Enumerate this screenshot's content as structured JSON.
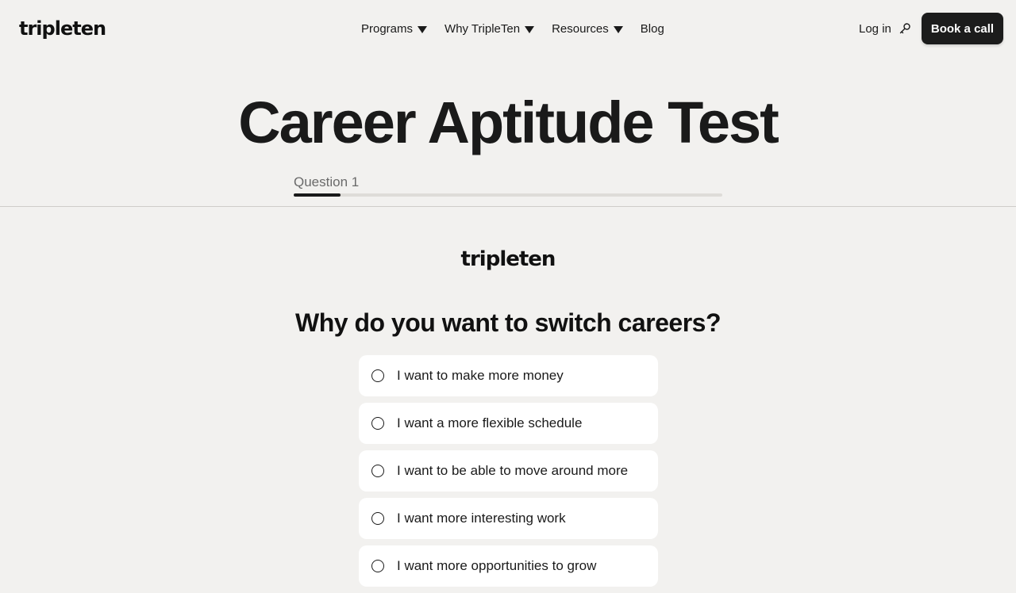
{
  "nav": {
    "logo": "tripleten",
    "menu": [
      {
        "label": "Programs",
        "icon": "caret-down-icon"
      },
      {
        "label": "Why TripleTen",
        "icon": "caret-down-icon"
      },
      {
        "label": "Resources",
        "icon": "caret-down-icon"
      },
      {
        "label": "Blog"
      }
    ],
    "login_label": "Log in",
    "login_icon": "key-icon",
    "cta_label": "Book a call"
  },
  "hero": {
    "title": "Career Aptitude Test",
    "question_label": "Question 1",
    "progress_fraction": 0.11
  },
  "quiz": {
    "logo": "tripleten",
    "question": "Why do you want to switch careers?",
    "options": [
      {
        "label": "I want to make more money"
      },
      {
        "label": "I want a more flexible schedule"
      },
      {
        "label": "I want to be able to move around more"
      },
      {
        "label": "I want more interesting work"
      },
      {
        "label": "I want more opportunities to grow"
      }
    ]
  },
  "colors": {
    "background": "#f2f1ef",
    "text": "#1a1a1a",
    "cta_background": "#1c1c1c",
    "card": "#ffffff",
    "progress_track": "#dedcd8"
  }
}
